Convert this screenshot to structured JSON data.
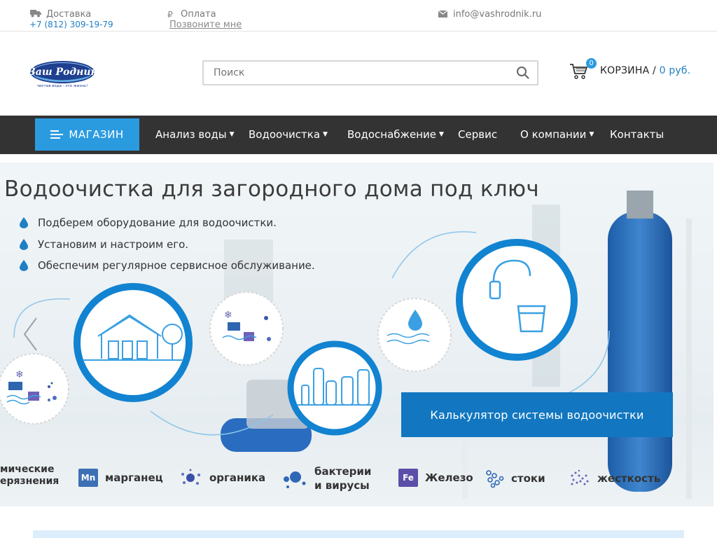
{
  "topbar": {
    "delivery": "Доставка",
    "payment": "Оплата",
    "email": "info@vashrodnik.ru",
    "phone": "+7 (812) 309-19-79",
    "callme": "Позвоните мне"
  },
  "header": {
    "logo_text": "Ваш Родник",
    "logo_tagline": "чистая вода - это жизнь!",
    "search_placeholder": "Поиск",
    "cart_count": "0",
    "cart_label": "КОРЗИНА /",
    "cart_sum": "0 руб."
  },
  "nav": {
    "shop": "МАГАЗИН",
    "items": [
      {
        "label": "Анализ воды"
      },
      {
        "label": "Водоочистка"
      },
      {
        "label": "Водоснабжение"
      },
      {
        "label": "Сервис"
      },
      {
        "label": "О компании"
      },
      {
        "label": "Контакты"
      }
    ]
  },
  "banner": {
    "title": "Водоочистка для загородного дома под ключ",
    "bullets": [
      "Подберем оборудование для водоочистки.",
      "Установим и настроим его.",
      "Обеспечим регулярное сервисное обслуживание."
    ],
    "calc_button": "Калькулятор системы водоочистки",
    "legend": [
      {
        "text1": "мические",
        "text2": "ерязнения",
        "icon": ""
      },
      {
        "text1": "марганец",
        "text2": "",
        "icon": "Mn"
      },
      {
        "text1": "органика",
        "text2": "",
        "icon": ""
      },
      {
        "text1": "бактерии",
        "text2": "и вирусы",
        "icon": ""
      },
      {
        "text1": "Железо",
        "text2": "",
        "icon": "Fe"
      },
      {
        "text1": "стоки",
        "text2": "",
        "icon": ""
      },
      {
        "text1": "жесткость",
        "text2": "",
        "icon": ""
      }
    ],
    "mn_label": "Mn",
    "fe_label": "Fe"
  },
  "colors": {
    "accent": "#2b9be0",
    "nav_bg": "#333333",
    "button_dark": "#1277c0",
    "ring_blue": "#1183d1"
  }
}
